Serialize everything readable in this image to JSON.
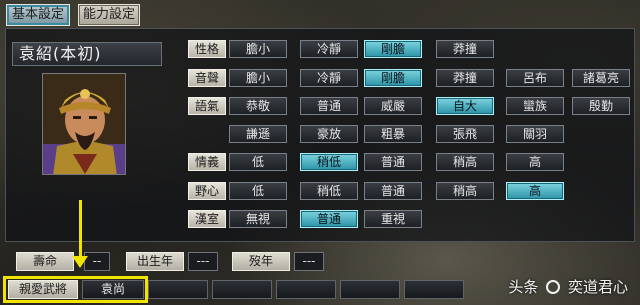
{
  "tabs": {
    "basic": "基本設定",
    "ability": "能力設定"
  },
  "officer": {
    "name": "袁紹(本初)"
  },
  "rows": [
    {
      "label": "性格",
      "options": [
        "膽小",
        "冷靜",
        "剛膽",
        "莽撞"
      ],
      "selected": 2
    },
    {
      "label": "音聲",
      "options": [
        "膽小",
        "冷靜",
        "剛膽",
        "莽撞",
        "呂布",
        "諸葛亮"
      ],
      "selected": 2
    },
    {
      "label": "語氣",
      "options": [
        "恭敬",
        "普通",
        "威嚴",
        "自大",
        "蠻族",
        "殷勤",
        "謙遜",
        "豪放",
        "粗暴",
        "張飛",
        "關羽"
      ],
      "selected": 3
    },
    {
      "label": "情義",
      "options": [
        "低",
        "稍低",
        "普通",
        "稍高",
        "高"
      ],
      "selected": 1
    },
    {
      "label": "野心",
      "options": [
        "低",
        "稍低",
        "普通",
        "稍高",
        "高"
      ],
      "selected": 4
    },
    {
      "label": "漢室",
      "options": [
        "無視",
        "普通",
        "重視"
      ],
      "selected": 1
    }
  ],
  "info": {
    "lifespan_label": "壽命",
    "lifespan_value": "--",
    "birth_label": "出生年",
    "birth_value": "---",
    "death_label": "歿年",
    "death_value": "---"
  },
  "bottom": {
    "favorite_label": "親愛武將",
    "favorite_value": "袁尚"
  },
  "watermark": {
    "prefix": "头条",
    "suffix": "奕道君心"
  },
  "colors": {
    "selected": "#2a93a6",
    "highlight": "#f3e400"
  }
}
